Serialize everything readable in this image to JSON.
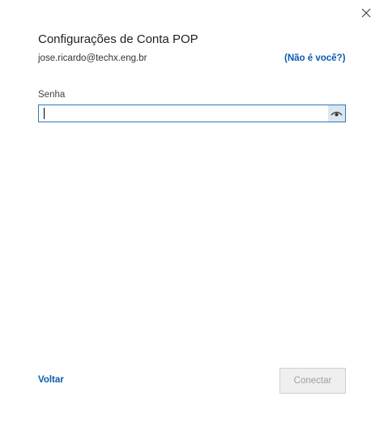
{
  "dialog": {
    "title": "Configurações de Conta POP",
    "email": "jose.ricardo@techx.eng.br",
    "not_you_link": "(Não é você?)",
    "close_icon": "close-icon"
  },
  "password": {
    "label": "Senha",
    "value": "",
    "reveal_icon": "eye-icon"
  },
  "footer": {
    "back_label": "Voltar",
    "connect_label": "Conectar",
    "connect_enabled": false
  },
  "colors": {
    "link": "#0b5cad",
    "focus_border": "#2b79c2",
    "disabled_bg": "#efefef",
    "disabled_text": "#a0a0a0"
  }
}
